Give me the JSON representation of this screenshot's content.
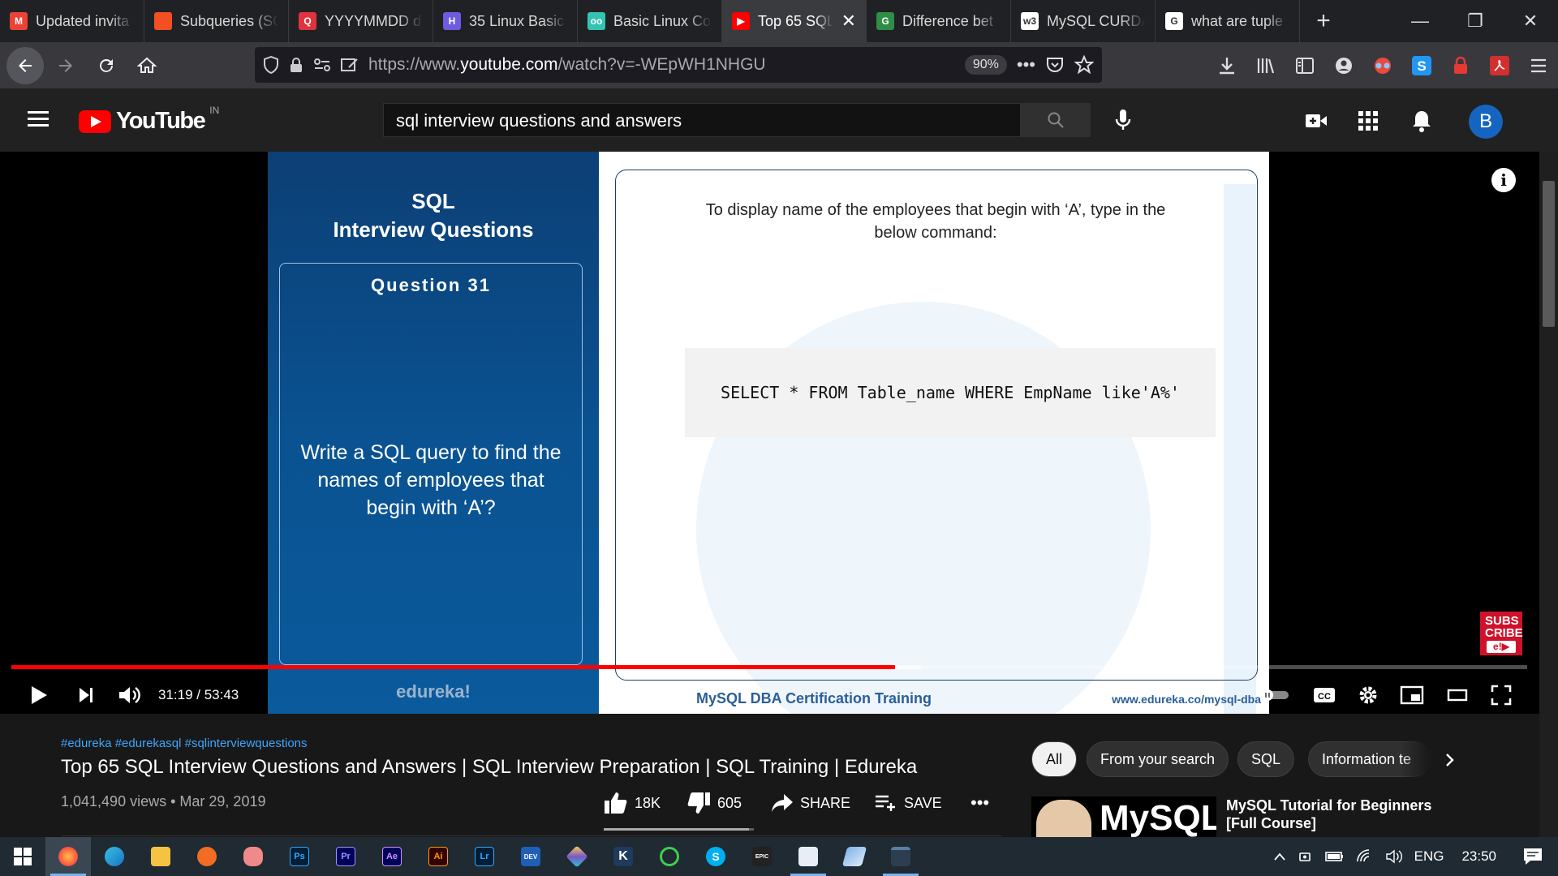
{
  "browser": {
    "tabs": [
      {
        "title": "Updated invita",
        "favicon": "gmail-icon",
        "color": "#ea4335",
        "glyph": "M"
      },
      {
        "title": "Subqueries (SQ",
        "favicon": "microsoft-icon",
        "color": "#f25022",
        "glyph": ""
      },
      {
        "title": "YYYYMMDD d",
        "favicon": "quora-icon",
        "color": "#e0333f",
        "glyph": "Q"
      },
      {
        "title": "35 Linux Basic",
        "favicon": "hashnode-icon",
        "color": "#6e5be0",
        "glyph": "H"
      },
      {
        "title": "Basic Linux Co",
        "favicon": "tutorial-icon",
        "color": "#34c3b3",
        "glyph": "oo"
      },
      {
        "title": "Top 65 SQL",
        "favicon": "youtube-icon",
        "color": "#ff0000",
        "glyph": "▶",
        "active": true
      },
      {
        "title": "Difference bet",
        "favicon": "gfg-icon",
        "color": "#2f8d46",
        "glyph": "G"
      },
      {
        "title": "MySQL CURDA",
        "favicon": "w3schools-icon",
        "color": "#ffffff",
        "glyph": "w3"
      },
      {
        "title": "what are tuple",
        "favicon": "google-icon",
        "color": "#ffffff",
        "glyph": "G"
      }
    ],
    "url_prefix": "https://www.",
    "url_domain": "youtube.com",
    "url_path": "/watch?v=-WEpWH1NHGU",
    "zoom": "90%"
  },
  "youtube": {
    "country": "IN",
    "search_query": "sql interview questions and answers",
    "avatar_letter": "B"
  },
  "slide": {
    "heading_line1": "SQL",
    "heading_line2": "Interview Questions",
    "question_number": "Question 31",
    "question_text": "Write a SQL query to find the names of employees that begin with ‘A’?",
    "brand": "edureka!",
    "answer_description": "To display name of the employees that begin with ‘A’, type in the below command:",
    "code": "SELECT * FROM Table_name WHERE EmpName like'A%'",
    "course": "MySQL DBA Certification Training",
    "website": "www.edureka.co/mysql-dba",
    "subscribe_text": "SUBS CRIBE",
    "subscribe_logo": "e!▶"
  },
  "player": {
    "current_time": "31:19",
    "duration": "53:43",
    "played_fraction": 0.583,
    "buffered_fraction": 0.6
  },
  "video": {
    "hashtags": "#edureka #edurekasql #sqlinterviewquestions",
    "title": "Top 65 SQL Interview Questions and Answers | SQL Interview Preparation | SQL Training | Edureka",
    "views": "1,041,490 views",
    "date": "Mar 29, 2019",
    "likes": "18K",
    "dislikes": "605",
    "share_label": "SHARE",
    "save_label": "SAVE"
  },
  "chips": [
    "All",
    "From your search",
    "SQL",
    "Information te"
  ],
  "recommendation": {
    "thumb_text": "MySQL",
    "title": "MySQL Tutorial for Beginners [Full Course]"
  },
  "taskbar": {
    "language": "ENG",
    "time": "23:50"
  }
}
